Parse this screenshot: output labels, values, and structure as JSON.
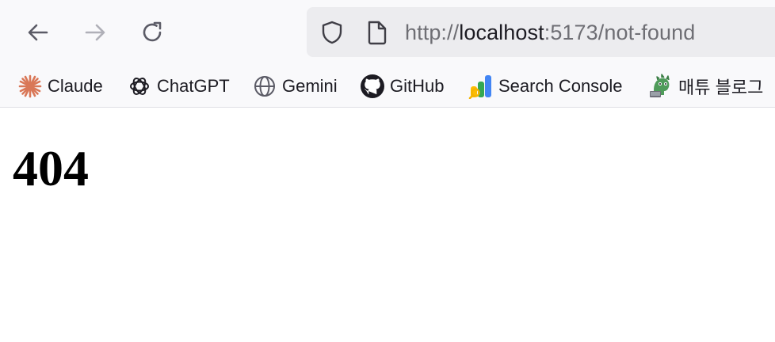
{
  "toolbar": {
    "back_icon": "arrow-left-icon",
    "forward_icon": "arrow-right-icon",
    "reload_icon": "reload-icon"
  },
  "url_bar": {
    "protocol": "http://",
    "host": "localhost",
    "rest": ":5173/not-found",
    "shield_icon": "shield-icon",
    "page_icon": "page-icon"
  },
  "bookmarks": [
    {
      "label": "Claude",
      "icon": "claude-icon",
      "color": "#d97757"
    },
    {
      "label": "ChatGPT",
      "icon": "chatgpt-icon",
      "color": "#1c1b22"
    },
    {
      "label": "Gemini",
      "icon": "globe-icon",
      "color": "#5b5b66"
    },
    {
      "label": "GitHub",
      "icon": "github-icon",
      "color": "#1c1b22"
    },
    {
      "label": "Search Console",
      "icon": "search-console-icon",
      "color": "#4285f4"
    },
    {
      "label": "매튜 블로그",
      "icon": "dinosaur-icon",
      "color": "#4f9b5a"
    }
  ],
  "page": {
    "heading": "404"
  }
}
